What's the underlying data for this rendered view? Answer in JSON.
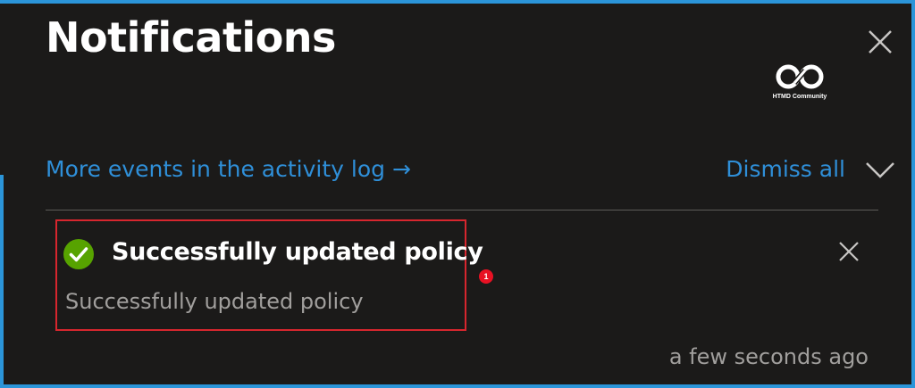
{
  "panel": {
    "title": "Notifications",
    "close_icon": "close-icon"
  },
  "watermark": {
    "logo_icon": "htmd-logo-icon",
    "text": "HTMD Community"
  },
  "toolbar": {
    "activity_link_label": "More events in the activity log →",
    "dismiss_all_label": "Dismiss all",
    "collapse_icon": "chevron-down-icon"
  },
  "notification": {
    "status_icon": "check-circle-icon",
    "title": "Successfully updated policy",
    "message": "Successfully updated policy",
    "timestamp": "a few seconds ago",
    "close_icon": "close-icon"
  },
  "annotation": {
    "badge": "1"
  },
  "colors": {
    "background": "#1b1a19",
    "frame": "#2b95d9",
    "link": "#2f8fd8",
    "success": "#57a300",
    "highlight_border": "#d7262e",
    "badge": "#e81123",
    "secondary_text": "#a19f9d"
  }
}
